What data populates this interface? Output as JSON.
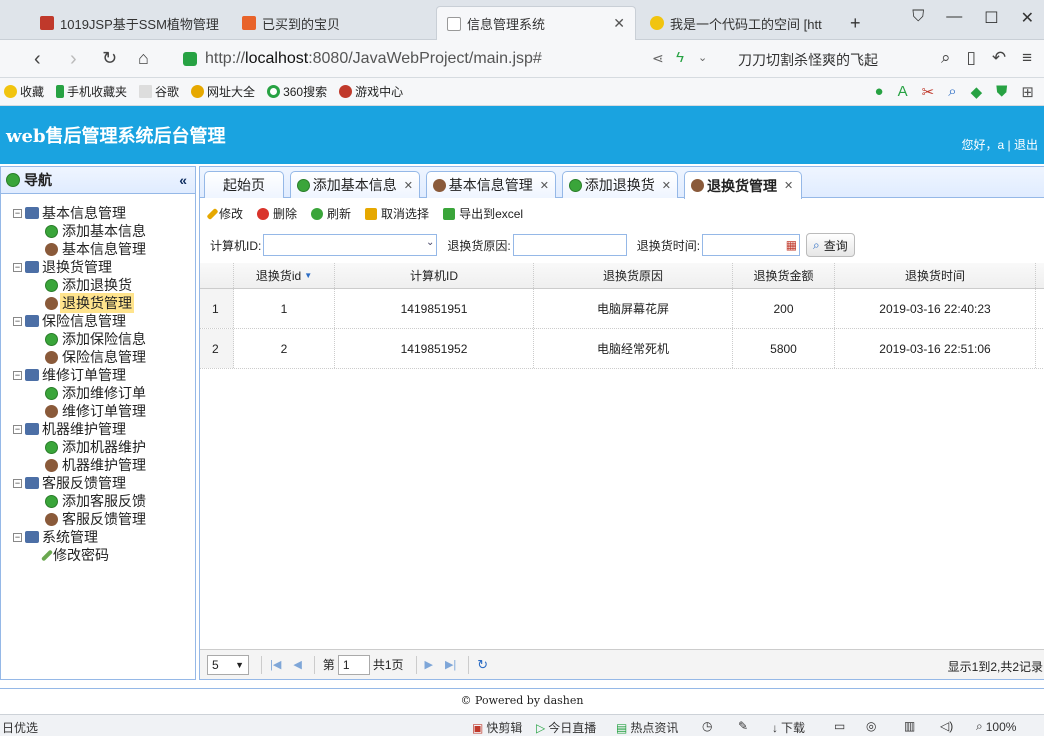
{
  "browser": {
    "tabs": [
      {
        "title": "1019JSP基于SSM植物管理",
        "active": false
      },
      {
        "title": "已买到的宝贝",
        "active": false
      },
      {
        "title": "信息管理系统",
        "active": true
      },
      {
        "title": "我是一个代码工的空间 [htt",
        "active": false
      }
    ],
    "url_prefix": "http://",
    "url_host": "localhost",
    "url_rest": ":8080/JavaWebProject/main.jsp#",
    "search_suggest": "刀刀切割杀怪爽的飞起",
    "bookmarks": [
      "收藏",
      "手机收藏夹",
      "谷歌",
      "网址大全",
      "360搜索",
      "游戏中心"
    ]
  },
  "app": {
    "title": "web售后管理系统后台管理",
    "greeting": "您好，a",
    "logout": "退出",
    "footer": "© Powered by dashen"
  },
  "sidebar": {
    "title": "导航",
    "collapse": "«",
    "groups": [
      {
        "label": "基本信息管理",
        "items": [
          {
            "label": "添加基本信息",
            "icon": "add"
          },
          {
            "label": "基本信息管理",
            "icon": "user"
          }
        ]
      },
      {
        "label": "退换货管理",
        "items": [
          {
            "label": "添加退换货",
            "icon": "add"
          },
          {
            "label": "退换货管理",
            "icon": "user",
            "selected": true
          }
        ]
      },
      {
        "label": "保险信息管理",
        "items": [
          {
            "label": "添加保险信息",
            "icon": "add"
          },
          {
            "label": "保险信息管理",
            "icon": "user"
          }
        ]
      },
      {
        "label": "维修订单管理",
        "items": [
          {
            "label": "添加维修订单",
            "icon": "add"
          },
          {
            "label": "维修订单管理",
            "icon": "user"
          }
        ]
      },
      {
        "label": "机器维护管理",
        "items": [
          {
            "label": "添加机器维护",
            "icon": "add"
          },
          {
            "label": "机器维护管理",
            "icon": "user"
          }
        ]
      },
      {
        "label": "客服反馈管理",
        "items": [
          {
            "label": "添加客服反馈",
            "icon": "add"
          },
          {
            "label": "客服反馈管理",
            "icon": "user"
          }
        ]
      },
      {
        "label": "系统管理",
        "items": [
          {
            "label": "修改密码",
            "icon": "pen"
          }
        ]
      }
    ]
  },
  "tabs": [
    {
      "label": "起始页",
      "closable": false
    },
    {
      "label": "添加基本信息",
      "closable": true
    },
    {
      "label": "基本信息管理",
      "closable": true
    },
    {
      "label": "添加退换货",
      "closable": true
    },
    {
      "label": "退换货管理",
      "closable": true,
      "active": true
    }
  ],
  "toolbar": {
    "edit": "修改",
    "delete": "删除",
    "refresh": "刷新",
    "unselect": "取消选择",
    "export": "导出到excel"
  },
  "filters": {
    "computer_id_label": "计算机ID:",
    "reason_label": "退换货原因:",
    "time_label": "退换货时间:",
    "query": "查询"
  },
  "grid": {
    "columns": [
      "",
      "退换货id",
      "计算机ID",
      "退换货原因",
      "退换货金额",
      "退换货时间"
    ],
    "rows": [
      [
        "1",
        "1",
        "1419851951",
        "电脑屏幕花屏",
        "200",
        "2019-03-16 22:40:23"
      ],
      [
        "2",
        "2",
        "1419851952",
        "电脑经常死机",
        "5800",
        "2019-03-16 22:51:06"
      ]
    ]
  },
  "pager": {
    "page_size": "5",
    "page_label": "第",
    "page_value": "1",
    "total_pages": "共1页",
    "info": "显示1到2,共2记录"
  },
  "statusbar": {
    "left": "日优选",
    "items": [
      "快剪辑",
      "今日直播",
      "热点资讯",
      "下载",
      "100%"
    ]
  },
  "colors": {
    "header_bg": "#1aa3e0",
    "border": "#95b8e7",
    "selected": "#ffe48d"
  }
}
